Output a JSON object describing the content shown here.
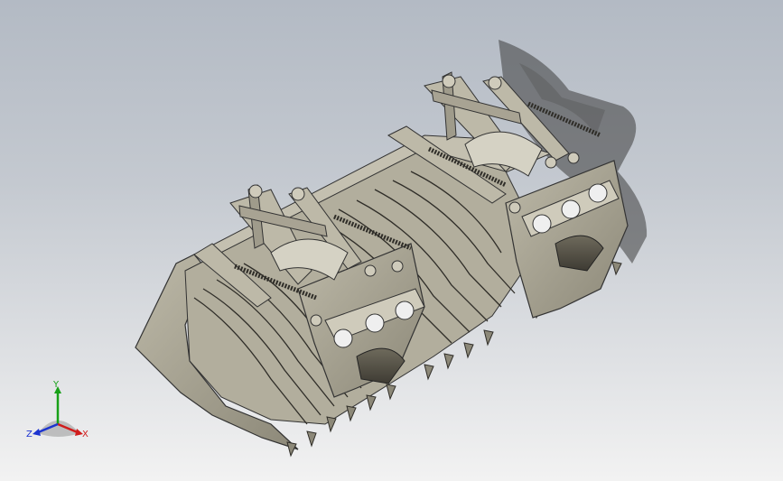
{
  "viewport": {
    "background_top": "#b3bac4",
    "background_bottom": "#f2f2f2"
  },
  "model": {
    "body_color": "#a8a393",
    "shade_color": "#5e5a4e",
    "shadow_color": "#3c3c3c"
  },
  "triad": {
    "y_label": "Y",
    "x_label": "X",
    "z_label": "Z",
    "y_color": "#17a017",
    "x_color": "#d01c1c",
    "z_color": "#1c34d0"
  }
}
